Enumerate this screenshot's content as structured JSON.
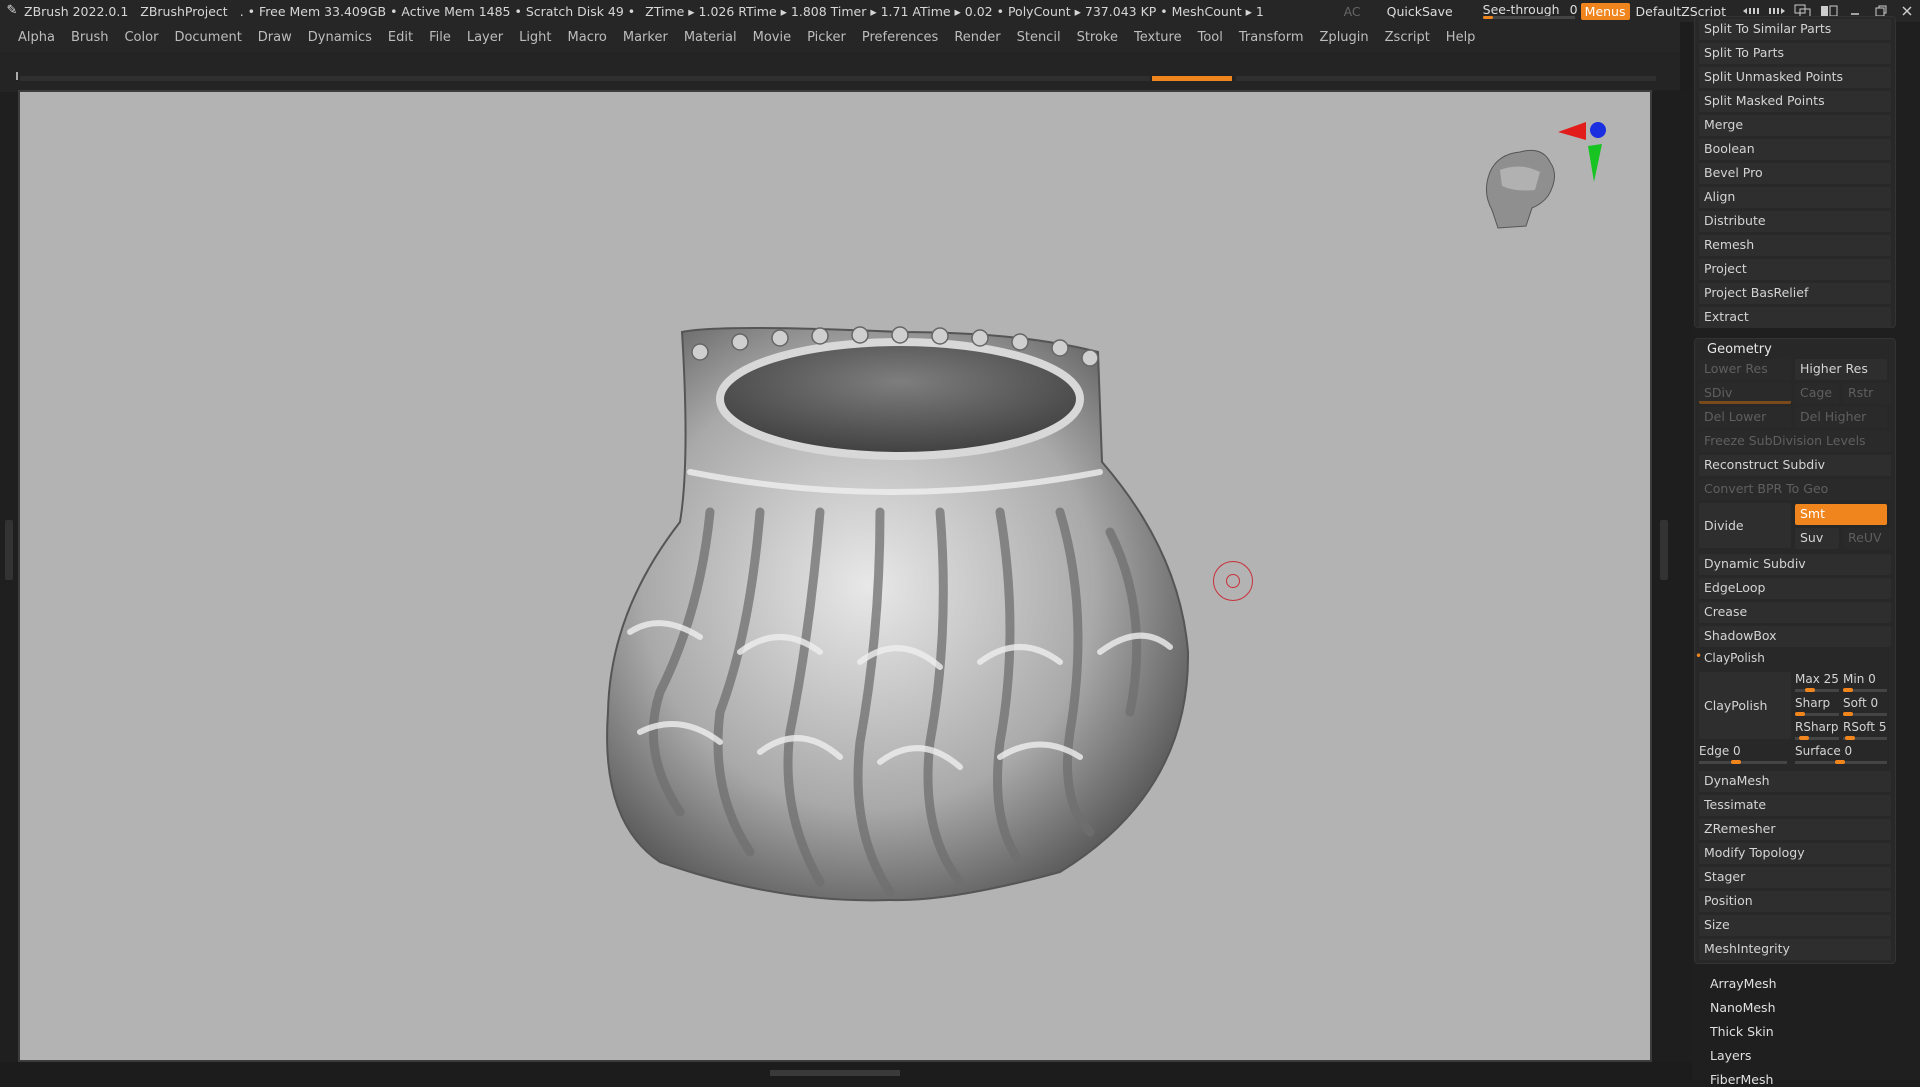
{
  "titlebar": {
    "app_title": "ZBrush 2022.0.1",
    "project": "ZBrushProject",
    "stats": ". • Free Mem 33.409GB • Active Mem 1485 • Scratch Disk 49 •",
    "timers": "ZTime ▸ 1.026 RTime ▸ 1.808 Timer ▸ 1.71 ATime ▸ 0.02 • PolyCount ▸ 737.043 KP • MeshCount ▸ 1",
    "ac": "AC",
    "quicksave": "QuickSave",
    "see_through_label": "See-through",
    "see_through_value": "0",
    "see_through_fraction": 0,
    "menus": "Menus",
    "default_zscript": "DefaultZScript"
  },
  "menubar": [
    "Alpha",
    "Brush",
    "Color",
    "Document",
    "Draw",
    "Dynamics",
    "Edit",
    "File",
    "Layer",
    "Light",
    "Macro",
    "Marker",
    "Material",
    "Movie",
    "Picker",
    "Preferences",
    "Render",
    "Stencil",
    "Stroke",
    "Texture",
    "Tool",
    "Transform",
    "Zplugin",
    "Zscript",
    "Help"
  ],
  "subtool_box": {
    "items": [
      "Split To Similar Parts",
      "Split To Parts",
      "Split Unmasked Points",
      "Split Masked Points",
      "Merge",
      "Boolean",
      "Bevel Pro",
      "Align",
      "Distribute",
      "Remesh",
      "Project",
      "Project BasRelief",
      "Extract"
    ]
  },
  "geometry": {
    "header": "Geometry",
    "lower_res": "Lower Res",
    "higher_res": "Higher Res",
    "sdiv": "SDiv",
    "cage": "Cage",
    "rstr": "Rstr",
    "del_lower": "Del Lower",
    "del_higher": "Del Higher",
    "freeze": "Freeze SubDivision Levels",
    "reconstruct": "Reconstruct Subdiv",
    "convert_bpr": "Convert BPR To Geo",
    "divide": "Divide",
    "smt": "Smt",
    "suv": "Suv",
    "reuv": "ReUV",
    "dynamic_subdiv": "Dynamic Subdiv",
    "edgeloop": "EdgeLoop",
    "crease": "Crease",
    "shadowbox": "ShadowBox",
    "claypolish_header": "ClayPolish",
    "claypolish_btn": "ClayPolish",
    "max": "Max 25",
    "min": "Min 0",
    "sharp": "Sharp",
    "soft": "Soft 0",
    "rsharp": "RSharp",
    "rsoft": "RSoft 5",
    "edge": "Edge 0",
    "surface": "Surface 0",
    "after": [
      "DynaMesh",
      "Tessimate",
      "ZRemesher",
      "Modify Topology",
      "Stager",
      "Position",
      "Size",
      "MeshIntegrity"
    ]
  },
  "lower_items": [
    "ArrayMesh",
    "NanoMesh",
    "Thick Skin",
    "Layers",
    "FiberMesh"
  ],
  "colors": {
    "accent": "#f0851e",
    "canvas": "#b3b3b3",
    "panel": "#1f1f1f"
  }
}
